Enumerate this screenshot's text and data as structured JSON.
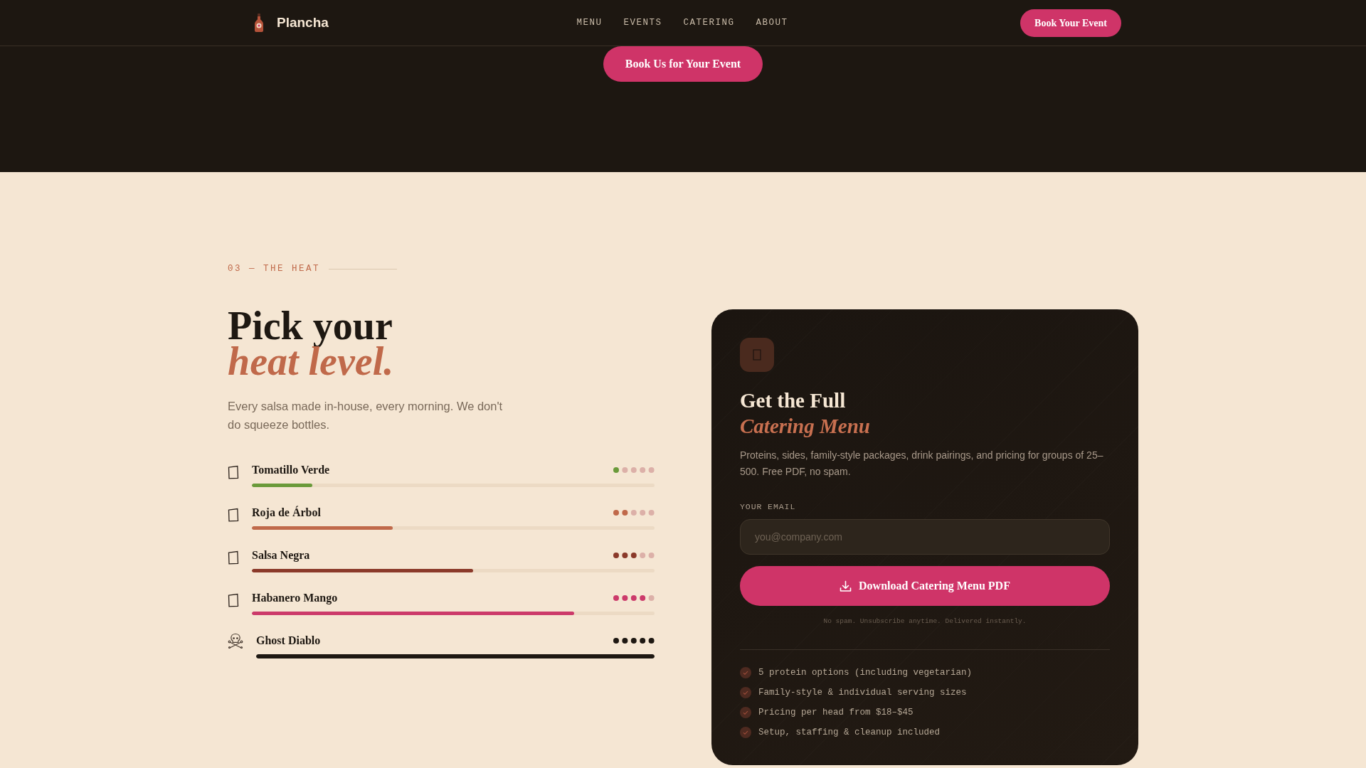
{
  "navbar": {
    "brand": "Plancha",
    "links": [
      "MENU",
      "EVENTS",
      "CATERING",
      "ABOUT"
    ],
    "cta": "Book Your Event"
  },
  "hero": {
    "button": "Book Us for Your Event"
  },
  "heat_section": {
    "eyebrow": "03 — THE HEAT",
    "heading": "Pick your",
    "heading_accent": "heat level.",
    "intro": "Every salsa made in-house, every morning. We don't do squeeze bottles.",
    "salsas": [
      {
        "kind": "box",
        "name": "Tomatillo Verde",
        "color": "#6a9a3a",
        "level": 0.15,
        "stars": 1
      },
      {
        "kind": "box",
        "name": "Roja de Árbol",
        "color": "#c0694a",
        "level": 0.35,
        "stars": 2
      },
      {
        "kind": "box",
        "name": "Salsa Negra",
        "color": "#8b3a2a",
        "level": 0.55,
        "stars": 3
      },
      {
        "kind": "box",
        "name": "Habanero Mango",
        "color": "#cc3a6a",
        "level": 0.8,
        "stars": 4
      },
      {
        "kind": "skull",
        "name": "Ghost Diablo",
        "color": "#1e1812",
        "level": 1,
        "stars": 5
      }
    ]
  },
  "catering_card": {
    "heading": "Get the Full",
    "heading_accent": "Catering Menu",
    "description": "Proteins, sides, family-style packages, drink pairings, and pricing for groups of 25–500. Free PDF, no spam.",
    "email_label": "YOUR EMAIL",
    "email_field": {
      "placeholder": "you@company.com"
    },
    "button": "Download Catering Menu PDF",
    "note": "No spam. Unsubscribe anytime. Delivered instantly.",
    "features": [
      "5 protein options (including vegetarian)",
      "Family-style & individual serving sizes",
      "Pricing per head from $18–$45",
      "Setup, staffing & cleanup included"
    ]
  }
}
